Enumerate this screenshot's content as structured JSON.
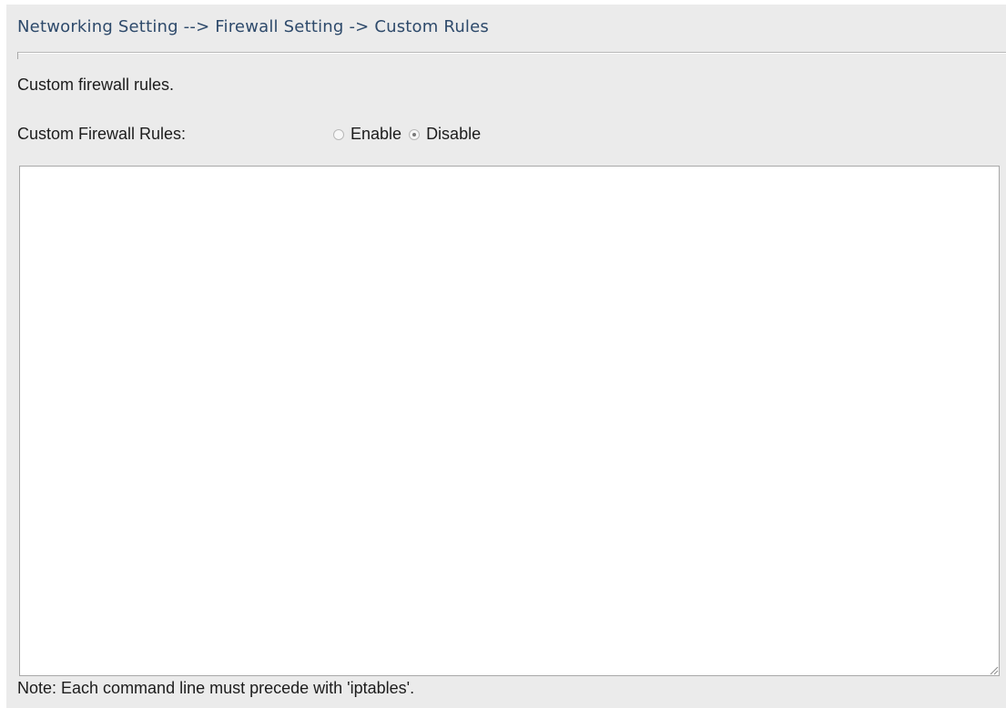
{
  "header": {
    "breadcrumb": "Networking Setting --> Firewall Setting -> Custom Rules"
  },
  "description": "Custom firewall rules.",
  "custom_rules": {
    "label": "Custom Firewall Rules:",
    "options": [
      {
        "label": "Enable",
        "selected": false
      },
      {
        "label": "Disable",
        "selected": true
      }
    ],
    "rules_text": ""
  },
  "note": "Note: Each command line must precede with 'iptables'."
}
